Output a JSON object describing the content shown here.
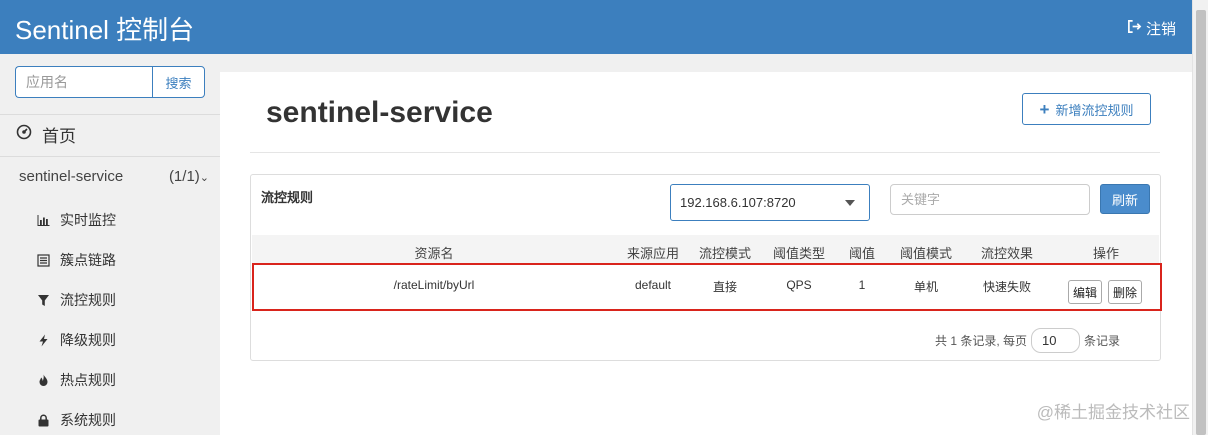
{
  "header": {
    "brand": "Sentinel 控制台",
    "logout_label": "注销",
    "logout_icon": "sign-out-icon",
    "bg_color": "#3c7fbe"
  },
  "sidebar": {
    "search": {
      "placeholder": "应用名",
      "value": "",
      "button_label": "搜索"
    },
    "home_label": "首页",
    "home_icon": "dashboard-icon",
    "app": {
      "name": "sentinel-service",
      "count": "(1/1)",
      "expanded": true
    },
    "items": [
      {
        "label": "实时监控",
        "icon": "bar-chart-icon"
      },
      {
        "label": "簇点链路",
        "icon": "list-icon"
      },
      {
        "label": "流控规则",
        "icon": "filter-icon"
      },
      {
        "label": "降级规则",
        "icon": "bolt-icon"
      },
      {
        "label": "热点规则",
        "icon": "fire-icon"
      },
      {
        "label": "系统规则",
        "icon": "lock-icon"
      }
    ]
  },
  "main": {
    "title": "sentinel-service",
    "add_button": "新增流控规则",
    "card_title": "流控规则",
    "machine_select": "192.168.6.107:8720",
    "keyword_placeholder": "关键字",
    "refresh_label": "刷新",
    "table": {
      "columns": [
        "资源名",
        "来源应用",
        "流控模式",
        "阈值类型",
        "阈值",
        "阈值模式",
        "流控效果",
        "操作"
      ],
      "rows": [
        {
          "resource": "/rateLimit/byUrl",
          "origin": "default",
          "mode": "直接",
          "grade": "QPS",
          "count": "1",
          "cluster": "单机",
          "effect": "快速失败",
          "edit_label": "编辑",
          "delete_label": "删除"
        }
      ]
    },
    "pager": {
      "prefix": "共 1 条记录, 每页",
      "page_size": "10",
      "suffix": "条记录"
    }
  },
  "watermark": "@稀土掘金技术社区",
  "highlight_color": "#d9241c"
}
